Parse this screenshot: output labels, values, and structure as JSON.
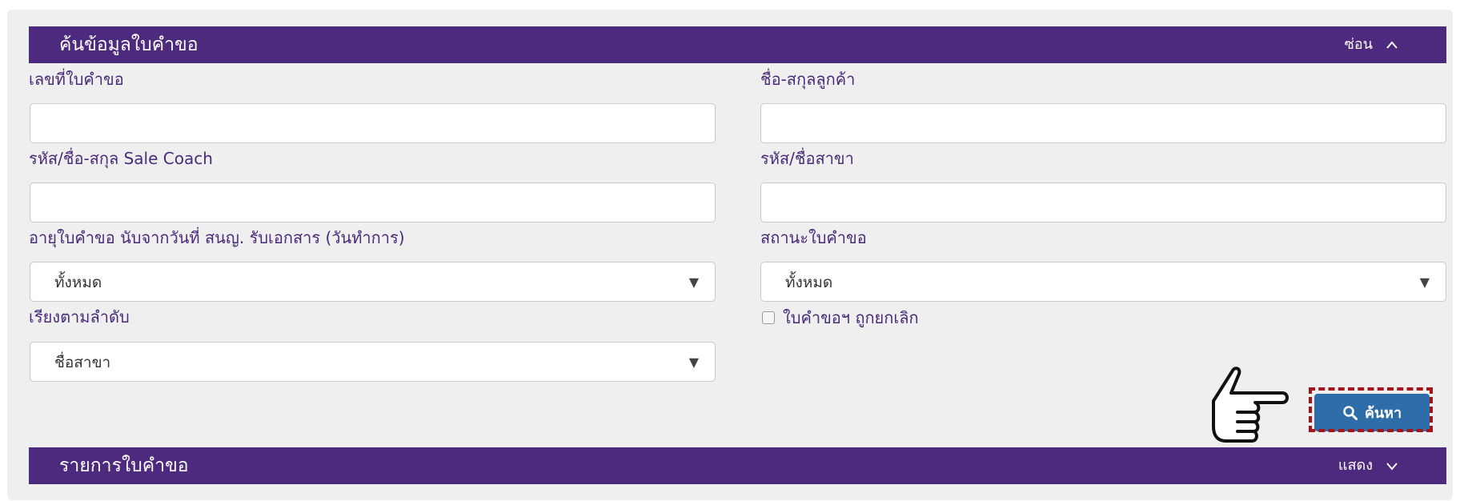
{
  "search_section": {
    "title": "ค้นข้อมูลใบคำขอ",
    "toggle_label": "ซ่อน"
  },
  "fields": {
    "request_no": {
      "label": "เลขที่ใบคำขอ",
      "value": ""
    },
    "customer_name": {
      "label": "ชื่อ-สกุลลูกค้า",
      "value": ""
    },
    "sale_coach": {
      "label": "รหัส/ชื่อ-สกุล Sale Coach",
      "value": ""
    },
    "branch": {
      "label": "รหัส/ชื่อสาขา",
      "value": ""
    },
    "request_age": {
      "label": "อายุใบคำขอ นับจากวันที่ สนญ. รับเอกสาร (วันทำการ)",
      "selected": "ทั้งหมด"
    },
    "request_status": {
      "label": "สถานะใบคำขอ",
      "selected": "ทั้งหมด"
    },
    "sort_by": {
      "label": "เรียงตามลำดับ",
      "selected": "ชื่อสาขา"
    },
    "cancelled_checkbox": {
      "label": "ใบคำขอฯ ถูกยกเลิก",
      "checked": false
    }
  },
  "search_button": {
    "label": "ค้นหา"
  },
  "results_section": {
    "title": "รายการใบคำขอ",
    "toggle_label": "แสดง"
  },
  "colors": {
    "header_bar": "#4e2a7e",
    "panel_bg": "#efefef",
    "button_blue": "#2f6da8",
    "highlight_red": "#a3151b",
    "label_text": "#4a2b7a"
  },
  "icons": {
    "hide_toggle": "chevron-up-icon",
    "show_toggle": "chevron-down-icon",
    "search": "search-icon",
    "pointer": "pointing-hand-icon",
    "select_arrow": "caret-down-icon"
  }
}
